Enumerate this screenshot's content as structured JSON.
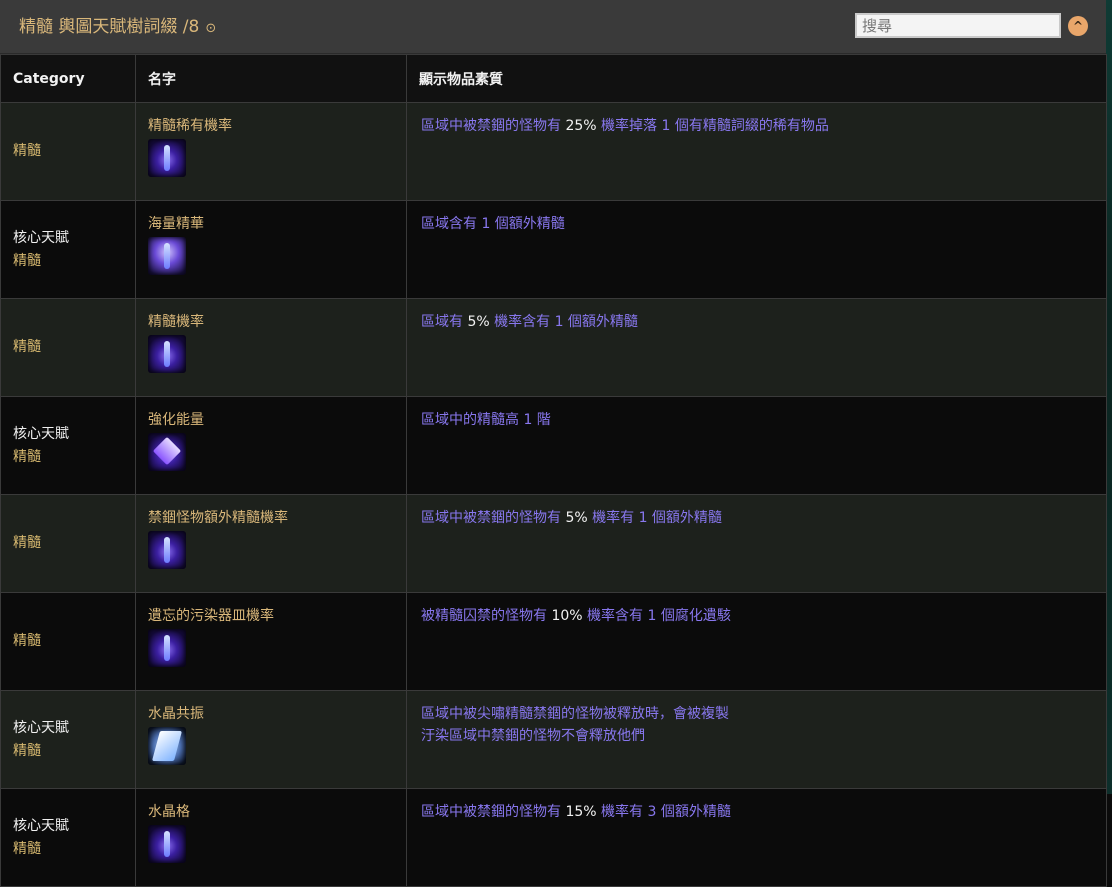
{
  "header": {
    "title": "精髓 輿圖天賦樹詞綴 /8",
    "info_glyph": "⊙",
    "search_placeholder": "搜尋",
    "collapse_glyph": "^"
  },
  "table": {
    "columns": [
      "Category",
      "名字",
      "顯示物品素質"
    ],
    "rows": [
      {
        "category": [
          "",
          "精髓"
        ],
        "name": "精髓稀有機率",
        "icon": "essence-icon",
        "desc": [
          [
            "區域中被禁錮的怪物有 ",
            "25%",
            " 機率掉落 1 個有精髓詞綴的稀有物品"
          ]
        ]
      },
      {
        "category": [
          "核心天賦",
          "精髓"
        ],
        "name": "海量精華",
        "icon": "essence-burst-icon",
        "desc": [
          [
            "區域含有 1 個額外精髓",
            "",
            ""
          ]
        ]
      },
      {
        "category": [
          "",
          "精髓"
        ],
        "name": "精髓機率",
        "icon": "essence-icon",
        "desc": [
          [
            "區域有 ",
            "5%",
            " 機率含有 1 個額外精髓"
          ]
        ]
      },
      {
        "category": [
          "核心天賦",
          "精髓"
        ],
        "name": "強化能量",
        "icon": "pyramid-icon",
        "desc": [
          [
            "區域中的精髓高 1 階",
            "",
            ""
          ]
        ]
      },
      {
        "category": [
          "",
          "精髓"
        ],
        "name": "禁錮怪物額外精髓機率",
        "icon": "essence-icon",
        "desc": [
          [
            "區域中被禁錮的怪物有 ",
            "5%",
            " 機率有 1 個額外精髓"
          ]
        ]
      },
      {
        "category": [
          "",
          "精髓"
        ],
        "name": "遺忘的污染器皿機率",
        "icon": "essence-icon",
        "desc": [
          [
            "被精髓囚禁的怪物有 ",
            "10%",
            " 機率含有 1 個腐化遺駭"
          ]
        ]
      },
      {
        "category": [
          "核心天賦",
          "精髓"
        ],
        "name": "水晶共振",
        "icon": "crystal-icon",
        "desc": [
          [
            "區域中被尖嘯精髓禁錮的怪物被釋放時，會被複製",
            "",
            ""
          ],
          [
            "汙染區域中禁錮的怪物不會釋放他們",
            "",
            ""
          ]
        ]
      },
      {
        "category": [
          "核心天賦",
          "精髓"
        ],
        "name": "水晶格",
        "icon": "essence-icon",
        "desc": [
          [
            "區域中被禁錮的怪物有 ",
            "15%",
            " 機率有 3 個額外精髓"
          ]
        ]
      }
    ]
  }
}
